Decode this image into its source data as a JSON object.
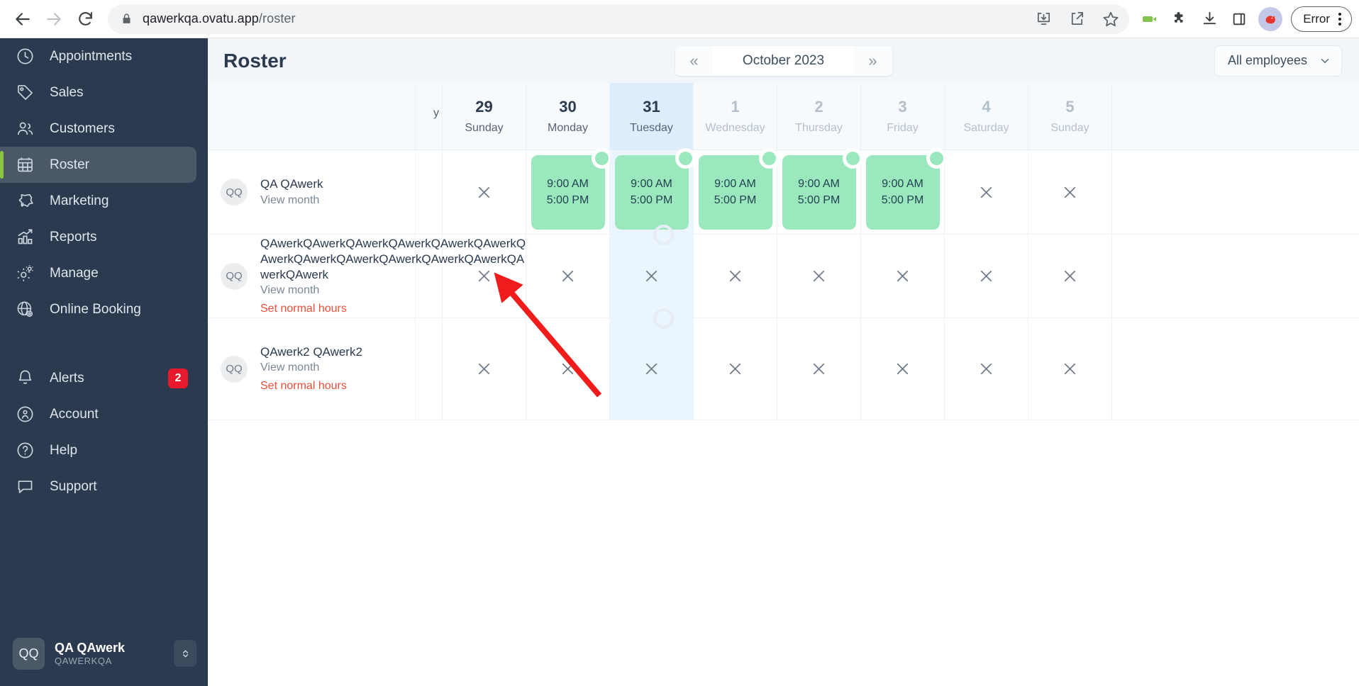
{
  "browser": {
    "url_host": "qawerkqa.ovatu.app",
    "url_path": "/roster",
    "back_icon": "back-arrow-icon",
    "forward_icon": "forward-arrow-icon",
    "reload_icon": "reload-icon",
    "lock_icon": "lock-icon",
    "toolbar_icons": [
      "install-app-icon",
      "share-icon",
      "bookmark-star-icon",
      "screen-recorder-icon",
      "extensions-puzzle-icon",
      "downloads-icon",
      "side-panel-icon"
    ],
    "profile_label": "profile-avatar",
    "error_pill": "Error",
    "menu_icon": "three-dot-menu-icon"
  },
  "sidebar": {
    "items": [
      {
        "label": "Appointments",
        "icon": "clock-icon",
        "active": false
      },
      {
        "label": "Sales",
        "icon": "tag-icon",
        "active": false
      },
      {
        "label": "Customers",
        "icon": "people-icon",
        "active": false
      },
      {
        "label": "Roster",
        "icon": "calendar-grid-icon",
        "active": true
      },
      {
        "label": "Marketing",
        "icon": "megaphone-icon",
        "active": false
      },
      {
        "label": "Reports",
        "icon": "bar-chart-icon",
        "active": false
      },
      {
        "label": "Manage",
        "icon": "gears-icon",
        "active": false
      },
      {
        "label": "Online Booking",
        "icon": "globe-gear-icon",
        "active": false
      }
    ],
    "bottom_items": [
      {
        "label": "Alerts",
        "icon": "bell-icon",
        "badge": "2"
      },
      {
        "label": "Account",
        "icon": "account-icon",
        "badge": ""
      },
      {
        "label": "Help",
        "icon": "question-icon",
        "badge": ""
      },
      {
        "label": "Support",
        "icon": "chat-icon",
        "badge": ""
      }
    ],
    "profile": {
      "initials": "QQ",
      "name": "QA QAwerk",
      "account": "QAWERKQA",
      "switch_icon": "up-down-chevron-icon"
    },
    "active_accent": "#8cc63f"
  },
  "header": {
    "title": "Roster",
    "prev_label": "«",
    "next_label": "»",
    "month_label": "October 2023",
    "employee_filter": "All employees",
    "filter_chevron": "chevron-down-icon"
  },
  "calendar": {
    "partial_column_label": "y",
    "days": [
      {
        "num": "29",
        "name": "Sunday",
        "today": false,
        "muted": false
      },
      {
        "num": "30",
        "name": "Monday",
        "today": false,
        "muted": false
      },
      {
        "num": "31",
        "name": "Tuesday",
        "today": true,
        "muted": false
      },
      {
        "num": "1",
        "name": "Wednesday",
        "today": false,
        "muted": true
      },
      {
        "num": "2",
        "name": "Thursday",
        "today": false,
        "muted": true
      },
      {
        "num": "3",
        "name": "Friday",
        "today": false,
        "muted": true
      },
      {
        "num": "4",
        "name": "Saturday",
        "today": false,
        "muted": true
      },
      {
        "num": "5",
        "name": "Sunday",
        "today": false,
        "muted": true
      }
    ],
    "shift_start": "9:00 AM",
    "shift_end": "5:00 PM",
    "off_icon": "close-x-icon",
    "shift_color": "#9ce8be",
    "today_color": "#ddeffc"
  },
  "rows": [
    {
      "initials": "QQ",
      "name": "QA QAwerk",
      "view_month": "View month",
      "set_hours": "",
      "long_name": false,
      "cells": [
        "off",
        "shift",
        "shift",
        "shift",
        "shift",
        "shift",
        "off",
        "off"
      ]
    },
    {
      "initials": "QQ",
      "name": "QAwerkQAwerkQAwerkQAwerkQAwerkQAwerkQAwerkQAwerkQAwerkQAwerkQAwerkQAwerkQAwerkQAwerk",
      "view_month": "View month",
      "set_hours": "Set normal hours",
      "long_name": true,
      "cells": [
        "off",
        "off",
        "off",
        "off",
        "off",
        "off",
        "off",
        "off"
      ]
    },
    {
      "initials": "QQ",
      "name": "QAwerk2 QAwerk2",
      "view_month": "View month",
      "set_hours": "Set normal hours",
      "long_name": false,
      "cells": [
        "off",
        "off",
        "off",
        "off",
        "off",
        "off",
        "off",
        "off"
      ]
    }
  ],
  "annotation": {
    "type": "red-arrow",
    "color": "#f01c1c"
  }
}
